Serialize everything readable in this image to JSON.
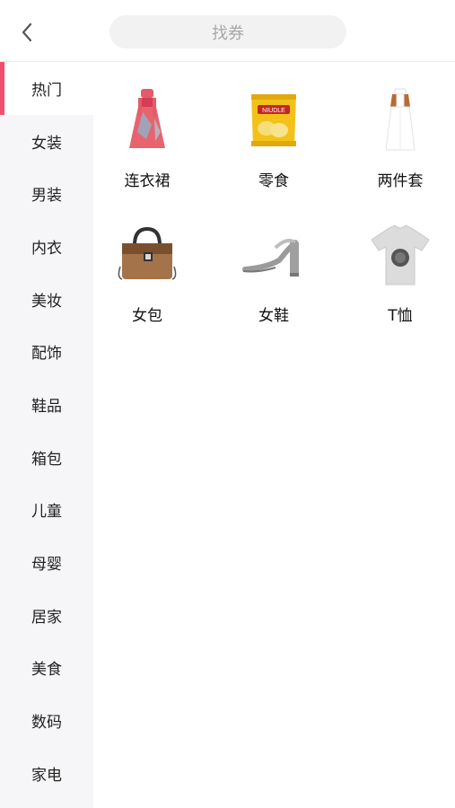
{
  "header": {
    "search_placeholder": "找券"
  },
  "sidebar": {
    "items": [
      {
        "label": "热门",
        "active": true
      },
      {
        "label": "女装"
      },
      {
        "label": "男装"
      },
      {
        "label": "内衣"
      },
      {
        "label": "美妆"
      },
      {
        "label": "配饰"
      },
      {
        "label": "鞋品"
      },
      {
        "label": "箱包"
      },
      {
        "label": "儿童"
      },
      {
        "label": "母婴"
      },
      {
        "label": "居家"
      },
      {
        "label": "美食"
      },
      {
        "label": "数码"
      },
      {
        "label": "家电"
      }
    ]
  },
  "categories": [
    {
      "label": "连衣裙",
      "icon": "dress-icon"
    },
    {
      "label": "零食",
      "icon": "snack-bag-icon",
      "package_text": "NIUDLE"
    },
    {
      "label": "两件套",
      "icon": "two-piece-dress-icon"
    },
    {
      "label": "女包",
      "icon": "handbag-icon"
    },
    {
      "label": "女鞋",
      "icon": "sandal-icon"
    },
    {
      "label": "T恤",
      "icon": "tshirt-icon"
    }
  ],
  "colors": {
    "accent": "#f0506e",
    "sidebar_bg": "#f6f6f8"
  }
}
